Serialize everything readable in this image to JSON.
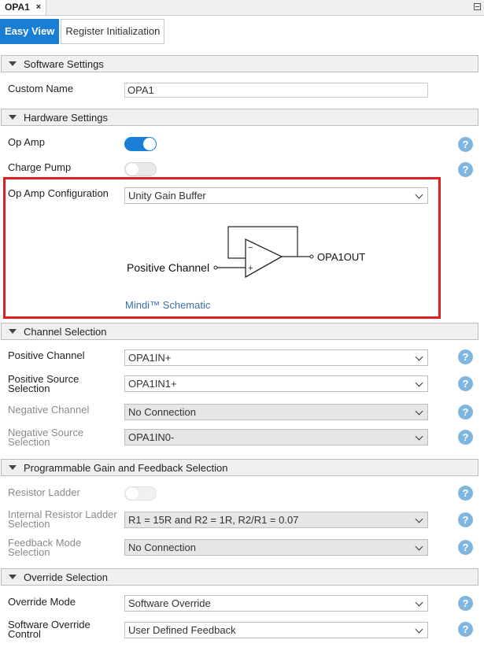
{
  "tab": {
    "title": "OPA1",
    "close": "×"
  },
  "view_tabs": {
    "easy": "Easy View",
    "register": "Register Initialization"
  },
  "sections": {
    "software": "Software Settings",
    "hardware": "Hardware Settings",
    "channel": "Channel Selection",
    "gain": "Programmable Gain and Feedback Selection",
    "override": "Override Selection"
  },
  "software": {
    "custom_name_label": "Custom Name",
    "custom_name_value": "OPA1"
  },
  "hardware": {
    "op_amp_label": "Op Amp",
    "op_amp_on": true,
    "charge_pump_label": "Charge Pump",
    "charge_pump_on": false,
    "config_label": "Op Amp Configuration",
    "config_value": "Unity Gain Buffer"
  },
  "schematic": {
    "positive_label": "Positive Channel",
    "output_label": "OPA1OUT",
    "minus_sign": "−",
    "plus_sign": "+",
    "link": "Mindi™ Schematic"
  },
  "channel": {
    "pos_channel_label": "Positive Channel",
    "pos_channel_value": "OPA1IN+",
    "pos_source_label": "Positive Source Selection",
    "pos_source_value": "OPA1IN1+",
    "neg_channel_label": "Negative Channel",
    "neg_channel_value": "No Connection",
    "neg_source_label": "Negative Source Selection",
    "neg_source_value": "OPA1IN0-"
  },
  "gain": {
    "ladder_label": "Resistor Ladder",
    "ladder_on": false,
    "internal_label": "Internal Resistor Ladder Selection",
    "internal_value": "R1 = 15R and R2 = 1R, R2/R1 = 0.07",
    "feedback_label": "Feedback Mode Selection",
    "feedback_value": "No Connection"
  },
  "override": {
    "mode_label": "Override Mode",
    "mode_value": "Software Override",
    "control_label": "Software Override Control",
    "control_value": "User Defined Feedback"
  },
  "help_glyph": "?",
  "colors": {
    "accent": "#1a7fd4",
    "highlight": "#e02020",
    "help": "#7fb6e0"
  }
}
